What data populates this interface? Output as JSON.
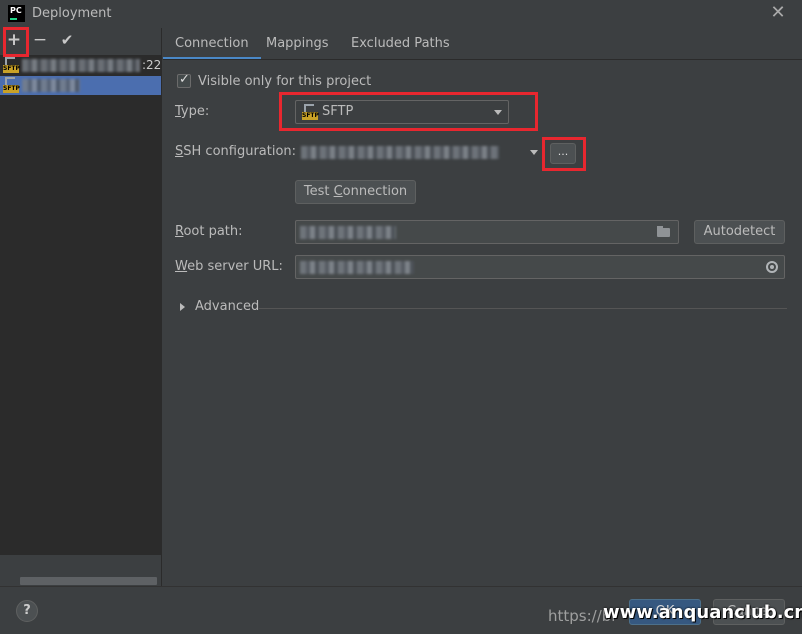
{
  "window": {
    "app_icon_text": "PC",
    "title": "Deployment",
    "close_glyph": "✕"
  },
  "left_toolbar": {
    "add_glyph": "+",
    "remove_glyph": "−",
    "check_glyph": "✔"
  },
  "servers": [
    {
      "badge": "SFTP",
      "suffix": ":22",
      "selected": false
    },
    {
      "badge": "SFTP",
      "suffix": "",
      "selected": true
    }
  ],
  "tabs": [
    {
      "label": "Connection",
      "active": true
    },
    {
      "label": "Mappings",
      "active": false
    },
    {
      "label": "Excluded Paths",
      "active": false
    }
  ],
  "connection": {
    "visible_only_label": "Visible only for this project",
    "visible_only_checked": true,
    "type_label_accel": "T",
    "type_label_rest": "ype:",
    "type_value": "SFTP",
    "type_badge": "SFTP",
    "ssh_label_accel": "S",
    "ssh_label_rest": "SH configuration:",
    "ssh_browse_label": "...",
    "test_button_pre": "Test ",
    "test_button_accel": "C",
    "test_button_post": "onnection",
    "root_label_accel": "R",
    "root_label_rest": "oot path:",
    "autodetect_label": "Autodetect",
    "web_label_accel": "W",
    "web_label_rest": "eb server URL:",
    "advanced_label": "Advanced"
  },
  "footer": {
    "help_label": "?",
    "ok_label": "OK",
    "cancel_label": "Cancel",
    "watermark_url": "https://bl",
    "watermark_site": "www.anquanclub.cn"
  },
  "colors": {
    "highlight_red": "#e8272f",
    "selection_blue": "#4b6eaf",
    "tab_underline": "#4a88c7",
    "sftp_badge": "#c9a227"
  }
}
